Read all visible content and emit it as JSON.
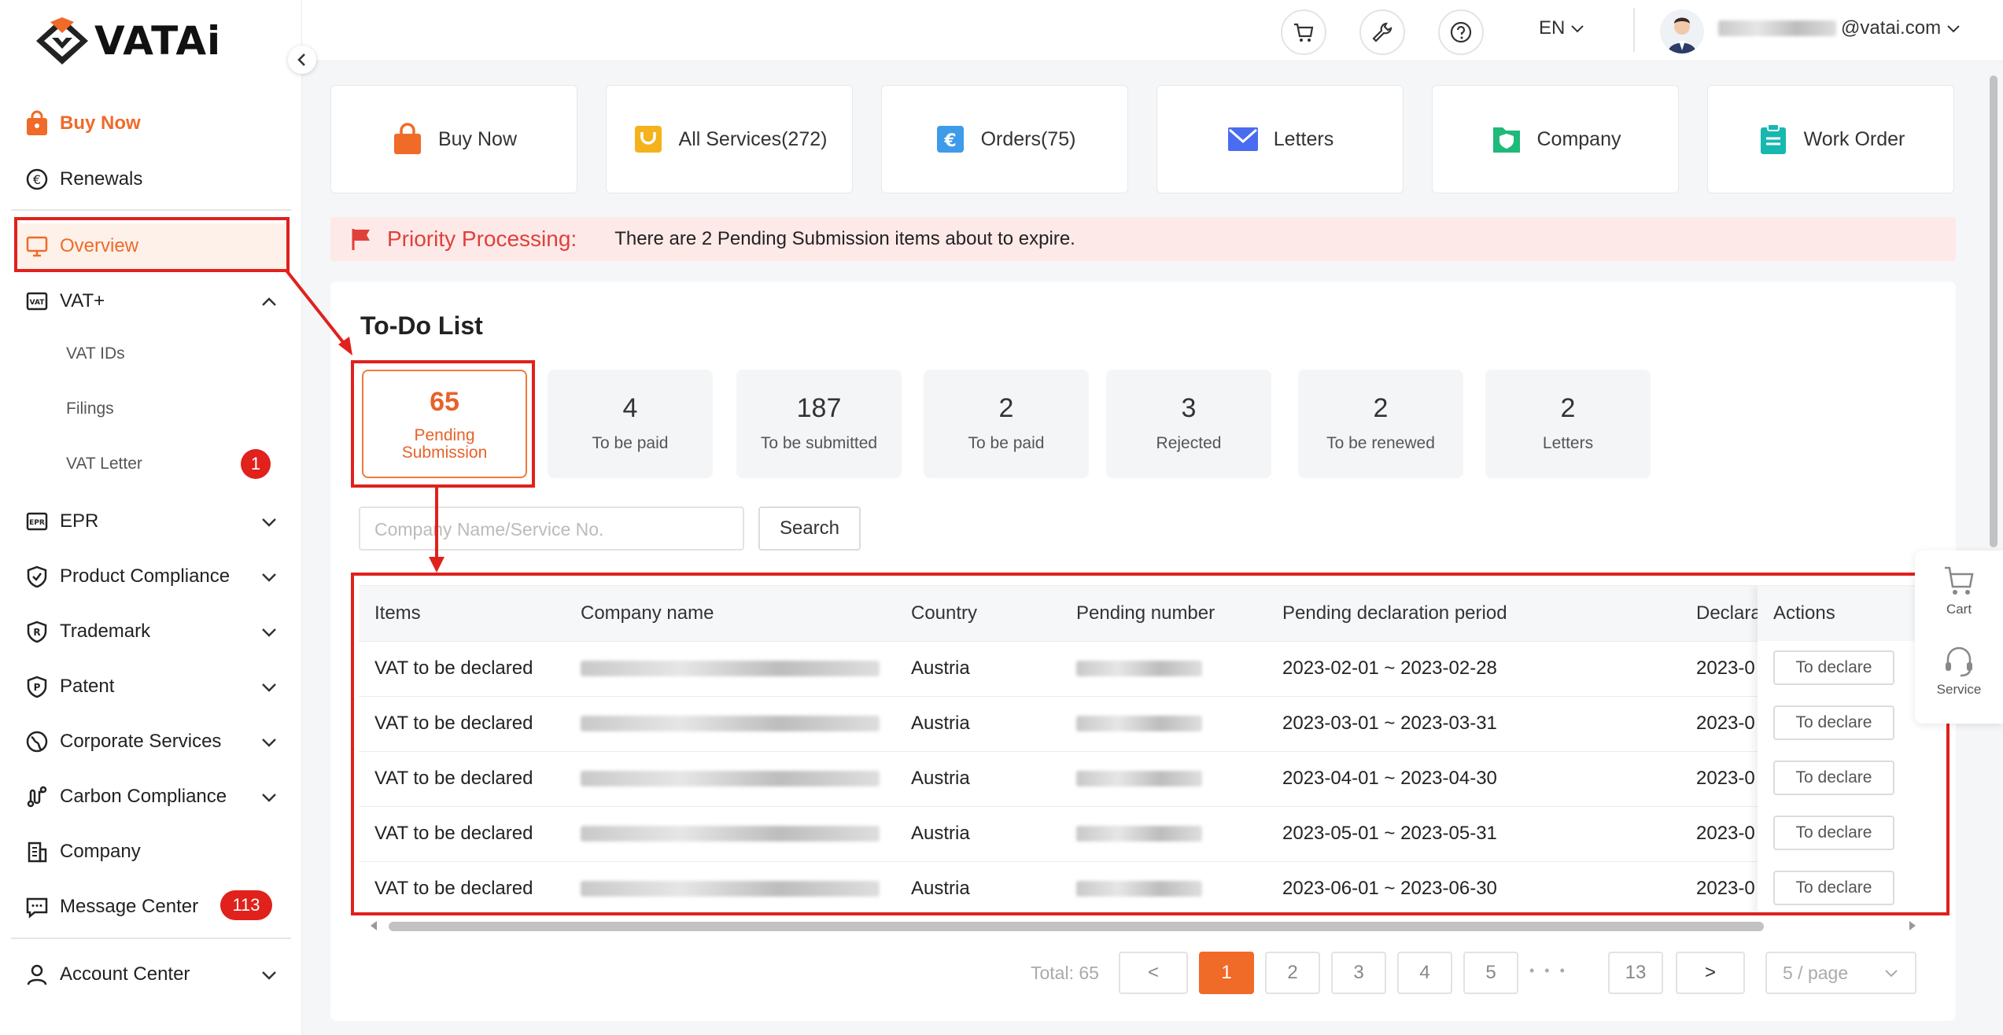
{
  "brand": {
    "name": "VATAi"
  },
  "sidebar": {
    "buy_now": "Buy Now",
    "renewals": "Renewals",
    "overview": "Overview",
    "vat": "VAT+",
    "vat_sub": [
      "VAT IDs",
      "Filings",
      "VAT Letter"
    ],
    "vat_letter_badge": "1",
    "epr": "EPR",
    "product_compliance": "Product Compliance",
    "trademark": "Trademark",
    "patent": "Patent",
    "corporate_services": "Corporate Services",
    "carbon_compliance": "Carbon Compliance",
    "company": "Company",
    "message_center": "Message Center",
    "message_badge": "113",
    "account_center": "Account Center"
  },
  "header": {
    "language": "EN",
    "email_domain": "@vatai.com"
  },
  "quick_cards": [
    "Buy Now",
    "All Services(272)",
    "Orders(75)",
    "Letters",
    "Company",
    "Work Order"
  ],
  "priority": {
    "label": "Priority Processing:",
    "text": "There are 2 Pending Submission items about to expire."
  },
  "todo": {
    "title": "To-Do List",
    "stats": [
      {
        "num": "65",
        "label": "Pending Submission"
      },
      {
        "num": "4",
        "label": "To be paid"
      },
      {
        "num": "187",
        "label": "To be submitted"
      },
      {
        "num": "2",
        "label": "To be paid"
      },
      {
        "num": "3",
        "label": "Rejected"
      },
      {
        "num": "2",
        "label": "To be renewed"
      },
      {
        "num": "2",
        "label": "Letters"
      }
    ],
    "search_placeholder": "Company Name/Service No.",
    "search_label": "Search"
  },
  "table": {
    "headers": [
      "Items",
      "Company name",
      "Country",
      "Pending number",
      "Pending declaration period",
      "Declara",
      "Actions"
    ],
    "rows": [
      {
        "item": "VAT to be declared",
        "country": "Austria",
        "period": "2023-02-01 ~ 2023-02-28",
        "decl": "2023-0",
        "action": "To declare"
      },
      {
        "item": "VAT to be declared",
        "country": "Austria",
        "period": "2023-03-01 ~ 2023-03-31",
        "decl": "2023-0",
        "action": "To declare"
      },
      {
        "item": "VAT to be declared",
        "country": "Austria",
        "period": "2023-04-01 ~ 2023-04-30",
        "decl": "2023-0",
        "action": "To declare"
      },
      {
        "item": "VAT to be declared",
        "country": "Austria",
        "period": "2023-05-01 ~ 2023-05-31",
        "decl": "2023-0",
        "action": "To declare"
      },
      {
        "item": "VAT to be declared",
        "country": "Austria",
        "period": "2023-06-01 ~ 2023-06-30",
        "decl": "2023-0",
        "action": "To declare"
      }
    ]
  },
  "pagination": {
    "total": "Total: 65",
    "prev": "<",
    "next": ">",
    "pages": [
      "1",
      "2",
      "3",
      "4",
      "5",
      "13"
    ],
    "ellipsis": "• • •",
    "per_page": "5 / page"
  },
  "float": {
    "cart": "Cart",
    "service": "Service"
  },
  "colors": {
    "accent": "#f06a28",
    "highlight": "#e0211c"
  }
}
